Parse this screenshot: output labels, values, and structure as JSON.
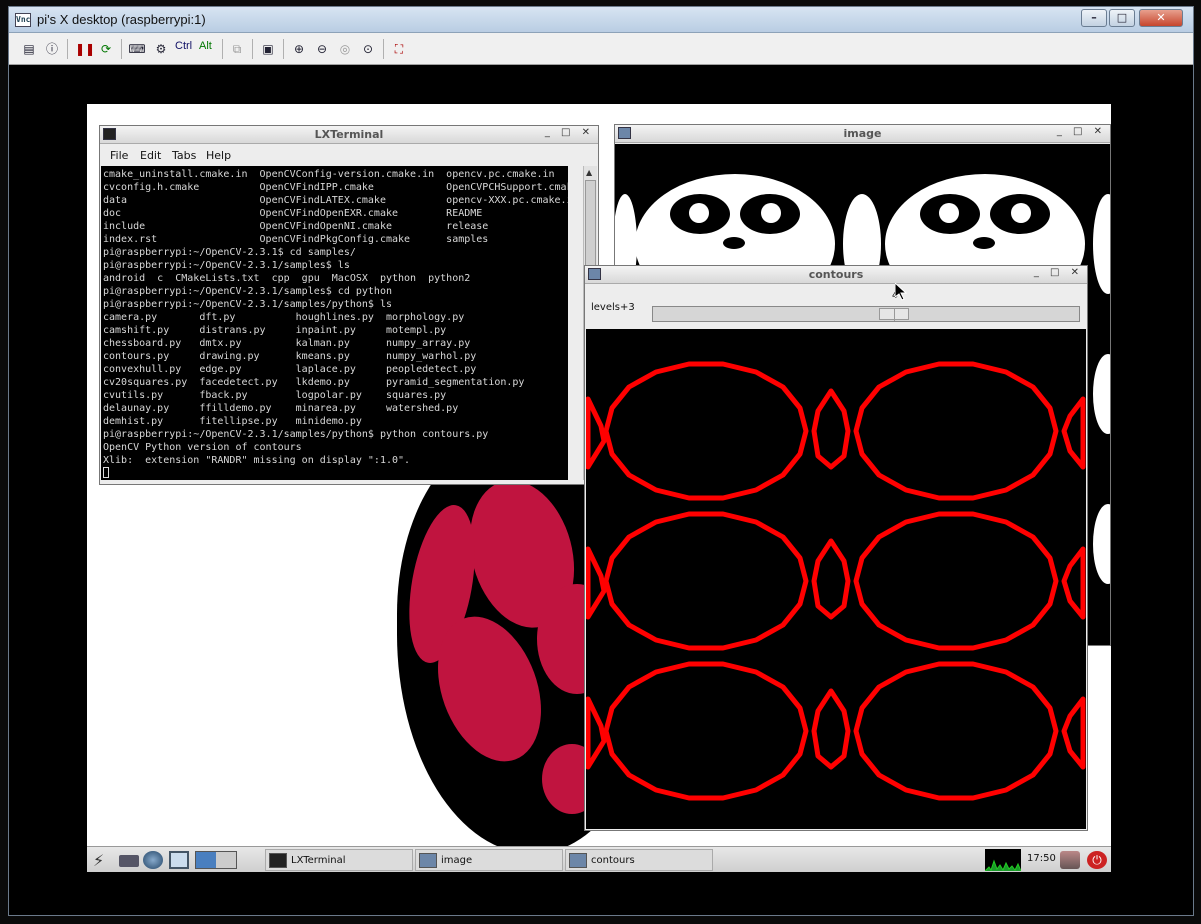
{
  "vnc": {
    "title": "pi's X desktop (raspberrypi:1)",
    "app_icon": "vnc-icon",
    "window_buttons": [
      "minimize",
      "maximize",
      "close"
    ],
    "toolbar": {
      "icons": [
        "options-icon",
        "info-icon",
        "pause-icon",
        "refresh-icon",
        "ctrl-alt-del-icon",
        "send-keys-icon"
      ],
      "ctrl_label": "Ctrl",
      "alt_label": "Alt",
      "more_icons": [
        "copy-icon",
        "save-icon",
        "zoom-in-icon",
        "zoom-out-icon",
        "zoom-100-icon",
        "zoom-fit-icon",
        "fullscreen-icon"
      ]
    }
  },
  "terminal": {
    "title": "LXTerminal",
    "menu": [
      "File",
      "Edit",
      "Tabs",
      "Help"
    ],
    "lines": [
      "cmake_uninstall.cmake.in  OpenCVConfig-version.cmake.in  opencv.pc.cmake.in",
      "cvconfig.h.cmake          OpenCVFindIPP.cmake            OpenCVPCHSupport.cmake",
      "data                      OpenCVFindLATEX.cmake          opencv-XXX.pc.cmake.in",
      "doc                       OpenCVFindOpenEXR.cmake        README",
      "include                   OpenCVFindOpenNI.cmake         release",
      "index.rst                 OpenCVFindPkgConfig.cmake      samples",
      "pi@raspberrypi:~/OpenCV-2.3.1$ cd samples/",
      "pi@raspberrypi:~/OpenCV-2.3.1/samples$ ls",
      "android  c  CMakeLists.txt  cpp  gpu  MacOSX  python  python2",
      "pi@raspberrypi:~/OpenCV-2.3.1/samples$ cd python",
      "pi@raspberrypi:~/OpenCV-2.3.1/samples/python$ ls",
      "camera.py       dft.py          houghlines.py  morphology.py",
      "camshift.py     distrans.py     inpaint.py     motempl.py",
      "chessboard.py   dmtx.py         kalman.py      numpy_array.py",
      "contours.py     drawing.py      kmeans.py      numpy_warhol.py",
      "convexhull.py   edge.py         laplace.py     peopledetect.py",
      "cv20squares.py  facedetect.py   lkdemo.py      pyramid_segmentation.py",
      "cvutils.py      fback.py        logpolar.py    squares.py",
      "delaunay.py     ffilldemo.py    minarea.py     watershed.py",
      "demhist.py      fitellipse.py   minidemo.py",
      "pi@raspberrypi:~/OpenCV-2.3.1/samples/python$ python contours.py",
      "OpenCV Python version of contours",
      "Xlib:  extension \"RANDR\" missing on display \":1.0\"."
    ]
  },
  "image_window": {
    "title": "image"
  },
  "contours_window": {
    "title": "contours",
    "slider": {
      "label": "levels+3",
      "value": "4",
      "position_fraction": 0.57
    },
    "contour_color": "#ff0000"
  },
  "taskbar": {
    "launcher_icons": [
      "menu-icon",
      "file-manager-icon",
      "browser-icon",
      "minimize-all-icon",
      "desktop-pager-icon"
    ],
    "tasks": [
      {
        "label": "LXTerminal",
        "icon": "terminal-icon"
      },
      {
        "label": "image",
        "icon": "window-icon"
      },
      {
        "label": "contours",
        "icon": "window-icon"
      }
    ],
    "clock": "17:50",
    "tray_icons": [
      "cpu-monitor-icon",
      "lock-screen-icon",
      "power-icon"
    ]
  }
}
